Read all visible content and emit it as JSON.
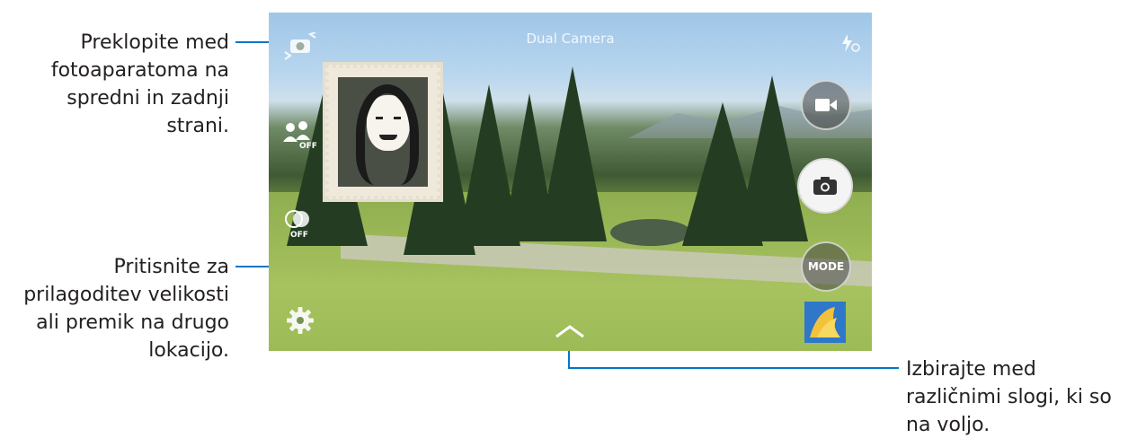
{
  "annotations": {
    "switch_camera": {
      "lines": [
        "Preklopite med",
        "fotoaparatoma na",
        "spredni in zadnji",
        "strani."
      ]
    },
    "resize": {
      "lines": [
        "Pritisnite za",
        "prilagoditev velikosti",
        "ali premik na drugo",
        "lokacijo."
      ]
    },
    "styles": {
      "lines": [
        "Izbirajte med",
        "različnimi slogi, ki so",
        "na voljo."
      ]
    }
  },
  "camera": {
    "title": "Dual Camera",
    "mode_label": "MODE",
    "off_label_1": "OFF",
    "off_label_2": "OFF"
  },
  "icons": {
    "switch": "switch-camera-icon",
    "flash": "flash-auto-icon",
    "record": "video-camera-icon",
    "capture": "camera-icon",
    "settings": "gear-icon",
    "gallery": "gallery-thumbnail-icon",
    "styles": "chevron-up-icon"
  },
  "colors": {
    "callout_line": "#0077c8",
    "text": "#231f20"
  }
}
